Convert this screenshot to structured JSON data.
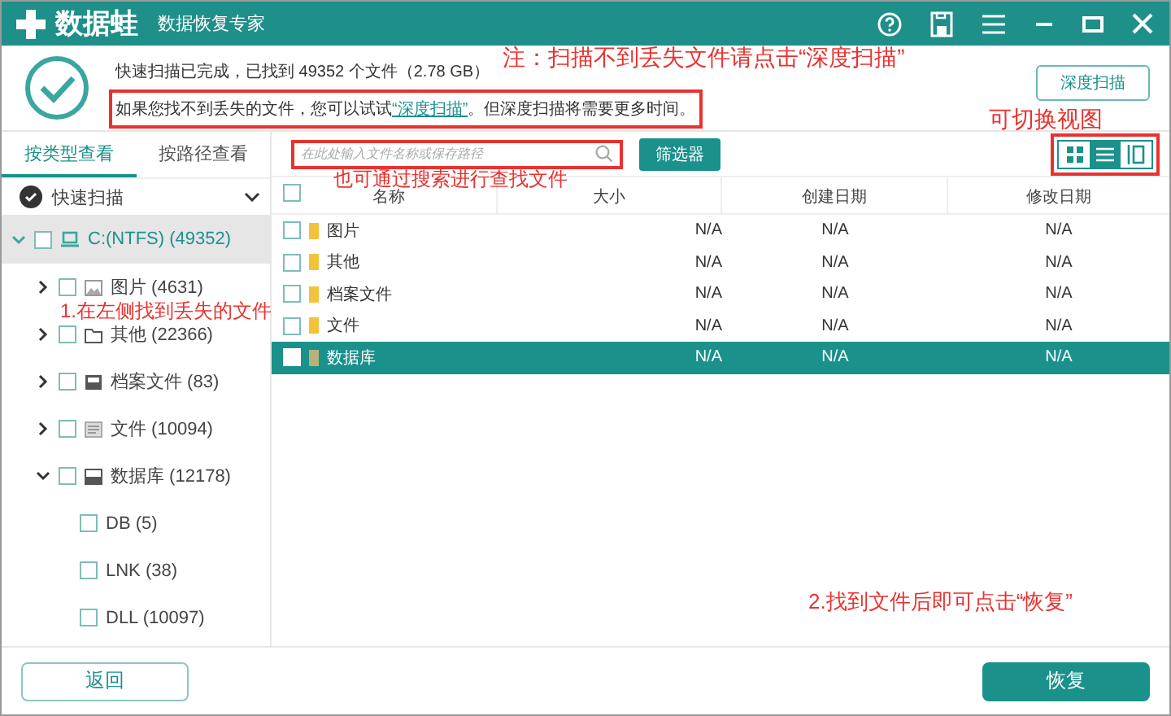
{
  "title_bar": {
    "logo": "数据蛙",
    "subtitle": "数据恢复专家"
  },
  "header": {
    "status": "快速扫描已完成，已找到 49352 个文件（2.78 GB）",
    "hint_before": "如果您找不到丢失的文件，您可以试试",
    "hint_link": "“深度扫描”",
    "hint_after": "。但深度扫描将需要更多时间。",
    "deep_scan_button": "深度扫描"
  },
  "sidebar": {
    "tabs": [
      {
        "label": "按类型查看",
        "selected": true
      },
      {
        "label": "按路径查看",
        "selected": false
      }
    ],
    "scan_select": "快速扫描",
    "tree": [
      {
        "label": "C:(NTFS) (49352)",
        "expanded": true,
        "selected": true,
        "checked": false,
        "children": [
          {
            "label": "图片 (4631)",
            "expanded": false,
            "checked": false
          },
          {
            "label": "其他 (22366)",
            "expanded": false,
            "checked": false
          },
          {
            "label": "档案文件 (83)",
            "expanded": false,
            "checked": false
          },
          {
            "label": "文件 (10094)",
            "expanded": false,
            "checked": false
          },
          {
            "label": "数据库 (12178)",
            "expanded": true,
            "checked": false,
            "children": [
              {
                "label": "DB (5)",
                "checked": false
              },
              {
                "label": "LNK (38)",
                "checked": false
              },
              {
                "label": "DLL (10097)",
                "checked": false
              }
            ]
          }
        ]
      }
    ]
  },
  "toolbar": {
    "search": {
      "placeholder": "在此处输入文件名称或保存路径"
    },
    "filter_button": "筛选器",
    "view_toggles": [
      {
        "selected": false
      },
      {
        "selected": true
      },
      {
        "selected": false
      }
    ]
  },
  "table": {
    "select_all_checked": false,
    "columns": [
      "名称",
      "大小",
      "创建日期",
      "修改日期"
    ],
    "rows": [
      {
        "name": "图片",
        "size": "N/A",
        "created": "N/A",
        "modified": "N/A",
        "selected": false,
        "checked": false
      },
      {
        "name": "其他",
        "size": "N/A",
        "created": "N/A",
        "modified": "N/A",
        "selected": false,
        "checked": false
      },
      {
        "name": "档案文件",
        "size": "N/A",
        "created": "N/A",
        "modified": "N/A",
        "selected": false,
        "checked": false
      },
      {
        "name": "文件",
        "size": "N/A",
        "created": "N/A",
        "modified": "N/A",
        "selected": false,
        "checked": false
      },
      {
        "name": "数据库",
        "size": "N/A",
        "created": "N/A",
        "modified": "N/A",
        "selected": true,
        "checked": false
      }
    ]
  },
  "footer": {
    "back_button": "返回",
    "recover_button": "恢复"
  },
  "annotations": [
    "注：扫描不到丢失文件请点击“深度扫描”",
    "可切换视图",
    "也可通过搜索进行查找文件",
    "1.在左侧找到丢失的文件",
    "2.找到文件后即可点击“恢复”"
  ]
}
